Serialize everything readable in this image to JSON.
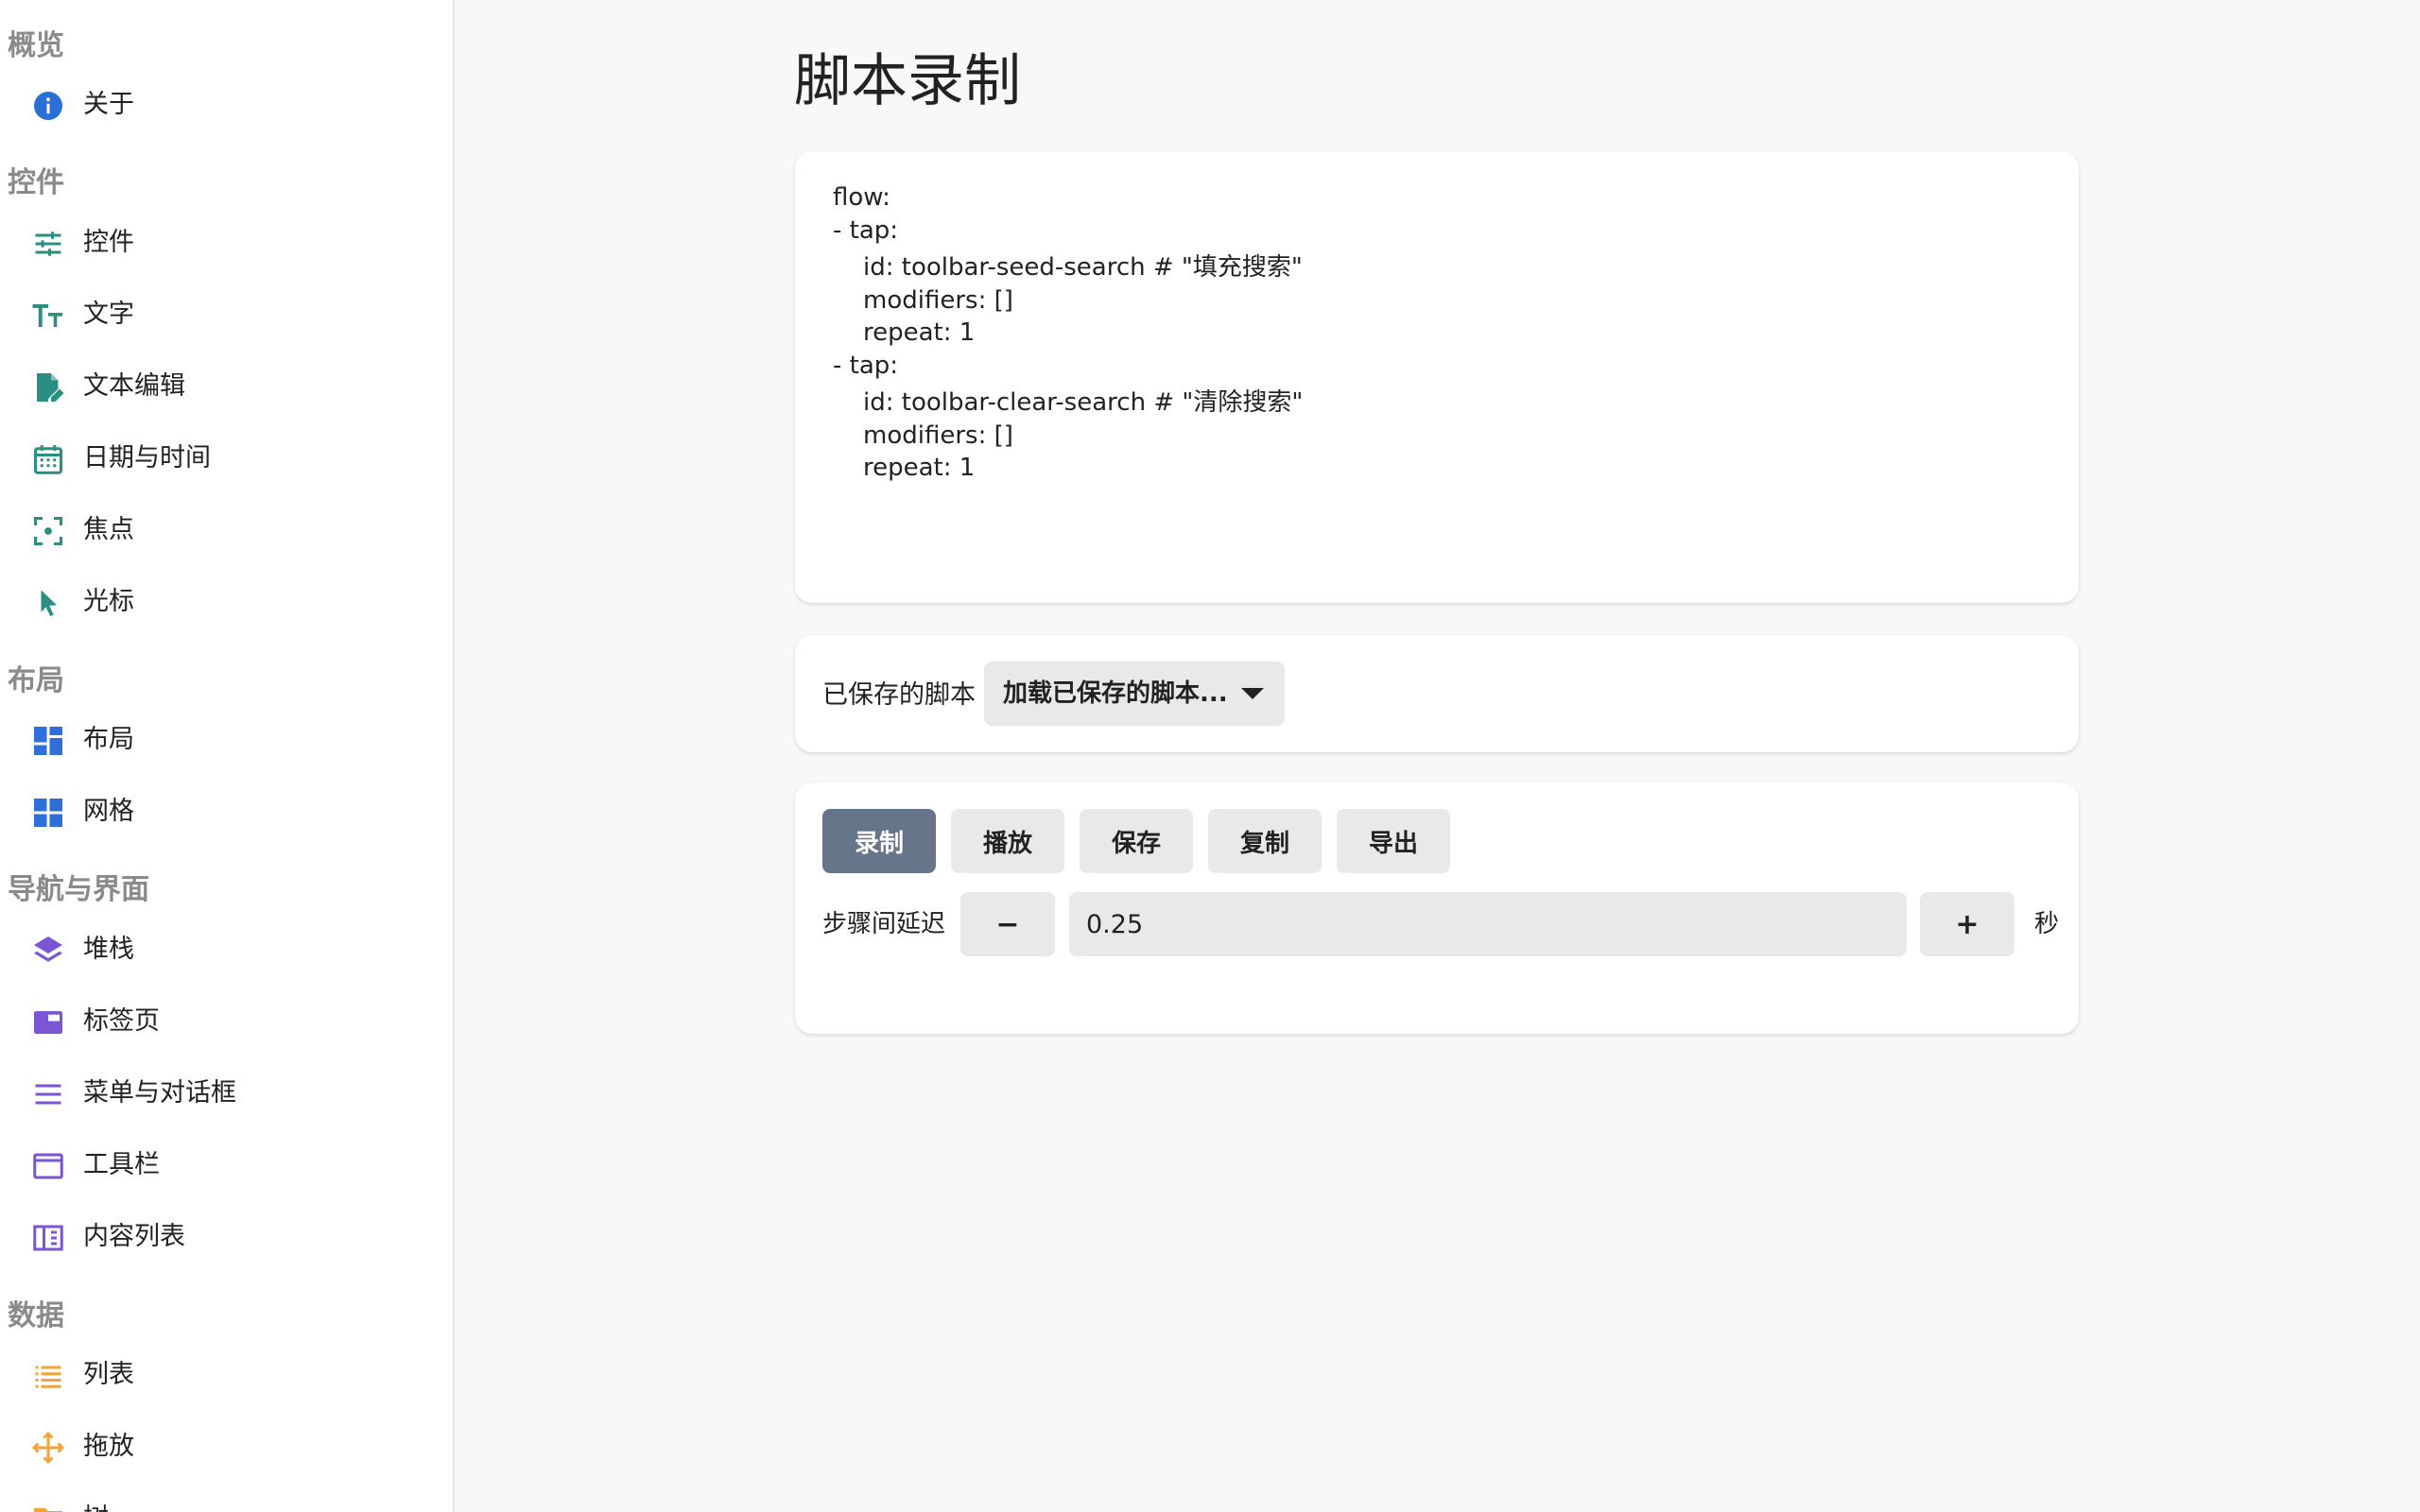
{
  "sidebar": {
    "sections": [
      {
        "header": "概览",
        "items": [
          {
            "label": "关于",
            "icon": "info-icon"
          }
        ]
      },
      {
        "header": "控件",
        "items": [
          {
            "label": "控件",
            "icon": "sliders-icon"
          },
          {
            "label": "文字",
            "icon": "text-size-icon"
          },
          {
            "label": "文本编辑",
            "icon": "edit-document-icon"
          },
          {
            "label": "日期与时间",
            "icon": "calendar-icon"
          },
          {
            "label": "焦点",
            "icon": "focus-icon"
          },
          {
            "label": "光标",
            "icon": "cursor-icon"
          }
        ]
      },
      {
        "header": "布局",
        "items": [
          {
            "label": "布局",
            "icon": "dashboard-icon"
          },
          {
            "label": "网格",
            "icon": "grid-icon"
          }
        ]
      },
      {
        "header": "导航与界面",
        "items": [
          {
            "label": "堆栈",
            "icon": "layers-icon"
          },
          {
            "label": "标签页",
            "icon": "tab-icon"
          },
          {
            "label": "菜单与对话框",
            "icon": "menu-icon"
          },
          {
            "label": "工具栏",
            "icon": "window-icon"
          },
          {
            "label": "内容列表",
            "icon": "split-view-icon"
          }
        ]
      },
      {
        "header": "数据",
        "items": [
          {
            "label": "列表",
            "icon": "list-icon"
          },
          {
            "label": "拖放",
            "icon": "drag-move-icon"
          },
          {
            "label": "树",
            "icon": "folder-icon"
          }
        ]
      }
    ]
  },
  "colors": {
    "info": "#2b6fd6",
    "teal": "#2a8f82",
    "blue": "#2f6fd9",
    "purple": "#7a56d6",
    "orange": "#f2a33a",
    "primary_button": "#67758a"
  },
  "main": {
    "title": "脚本录制",
    "script_lines": [
      "flow:",
      "- tap:",
      "id: toolbar-seed-search # \"填充搜索\"",
      "modifiers: []",
      "repeat: 1",
      "- tap:",
      "id: toolbar-clear-search # \"清除搜索\"",
      "modifiers: []",
      "repeat: 1"
    ],
    "saved": {
      "label": "已保存的脚本",
      "dropdown_value": "加载已保存的脚本..."
    },
    "buttons": {
      "record": "录制",
      "play": "播放",
      "save": "保存",
      "copy": "复制",
      "export": "导出"
    },
    "delay": {
      "label": "步骤间延迟",
      "minus": "−",
      "value": "0.25",
      "plus": "+",
      "unit": "秒"
    }
  }
}
